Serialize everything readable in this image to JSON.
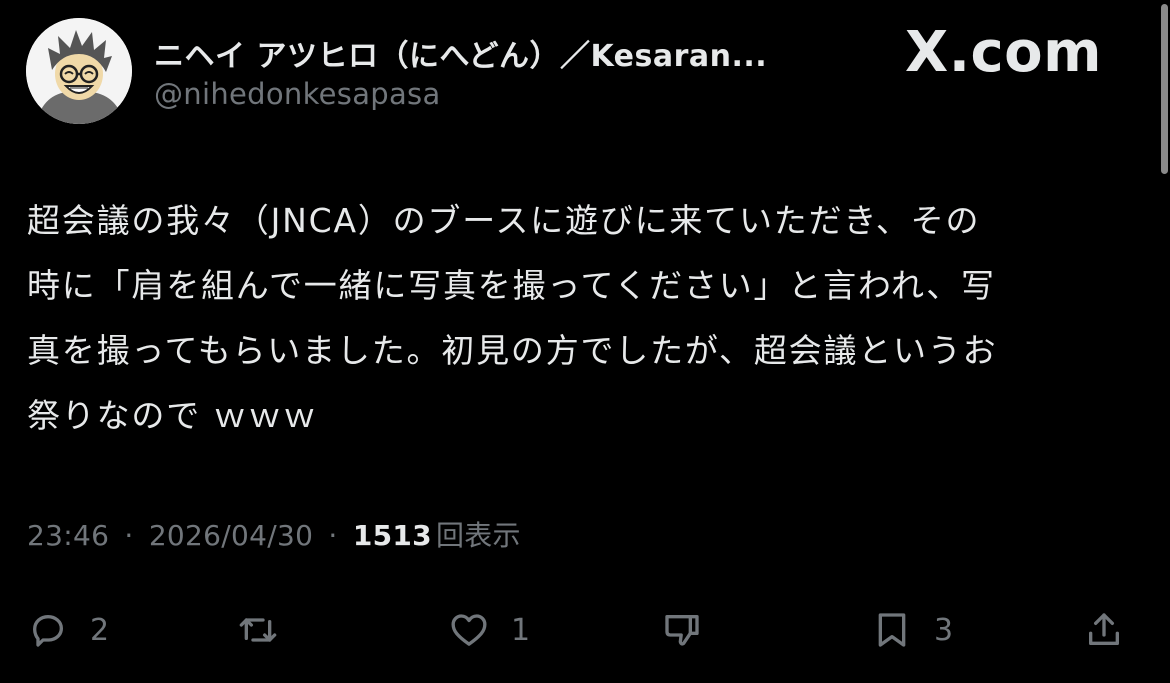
{
  "post": {
    "author_name": "ニヘイ アツヒロ（にへどん）／Kesaran...",
    "handle": "@nihedonkesapasa",
    "body": "超会議の我々（JNCA）のブースに遊びに来ていただき、その\n時に「肩を組んで一緒に写真を撮ってください」と言われ、写\n真を撮ってもらいました。初見の方でしたが、超会議というお\n祭りなので ｗｗｗ",
    "time": "23:46",
    "date": "2026/04/30",
    "separator": "·",
    "views_count": "1513",
    "views_label": "回表示"
  },
  "brand": {
    "label": "X.com"
  },
  "actions": {
    "reply": {
      "icon": "reply-icon",
      "count": "2"
    },
    "retweet": {
      "icon": "retweet-icon",
      "count": ""
    },
    "like": {
      "icon": "heart-icon",
      "count": "1"
    },
    "dislike": {
      "icon": "thumbs-down-icon",
      "count": ""
    },
    "bookmark": {
      "icon": "bookmark-icon",
      "count": "3"
    },
    "share": {
      "icon": "share-icon",
      "count": ""
    }
  },
  "colors": {
    "background": "#000000",
    "text": "#e7e9ea",
    "muted": "#71767b"
  }
}
